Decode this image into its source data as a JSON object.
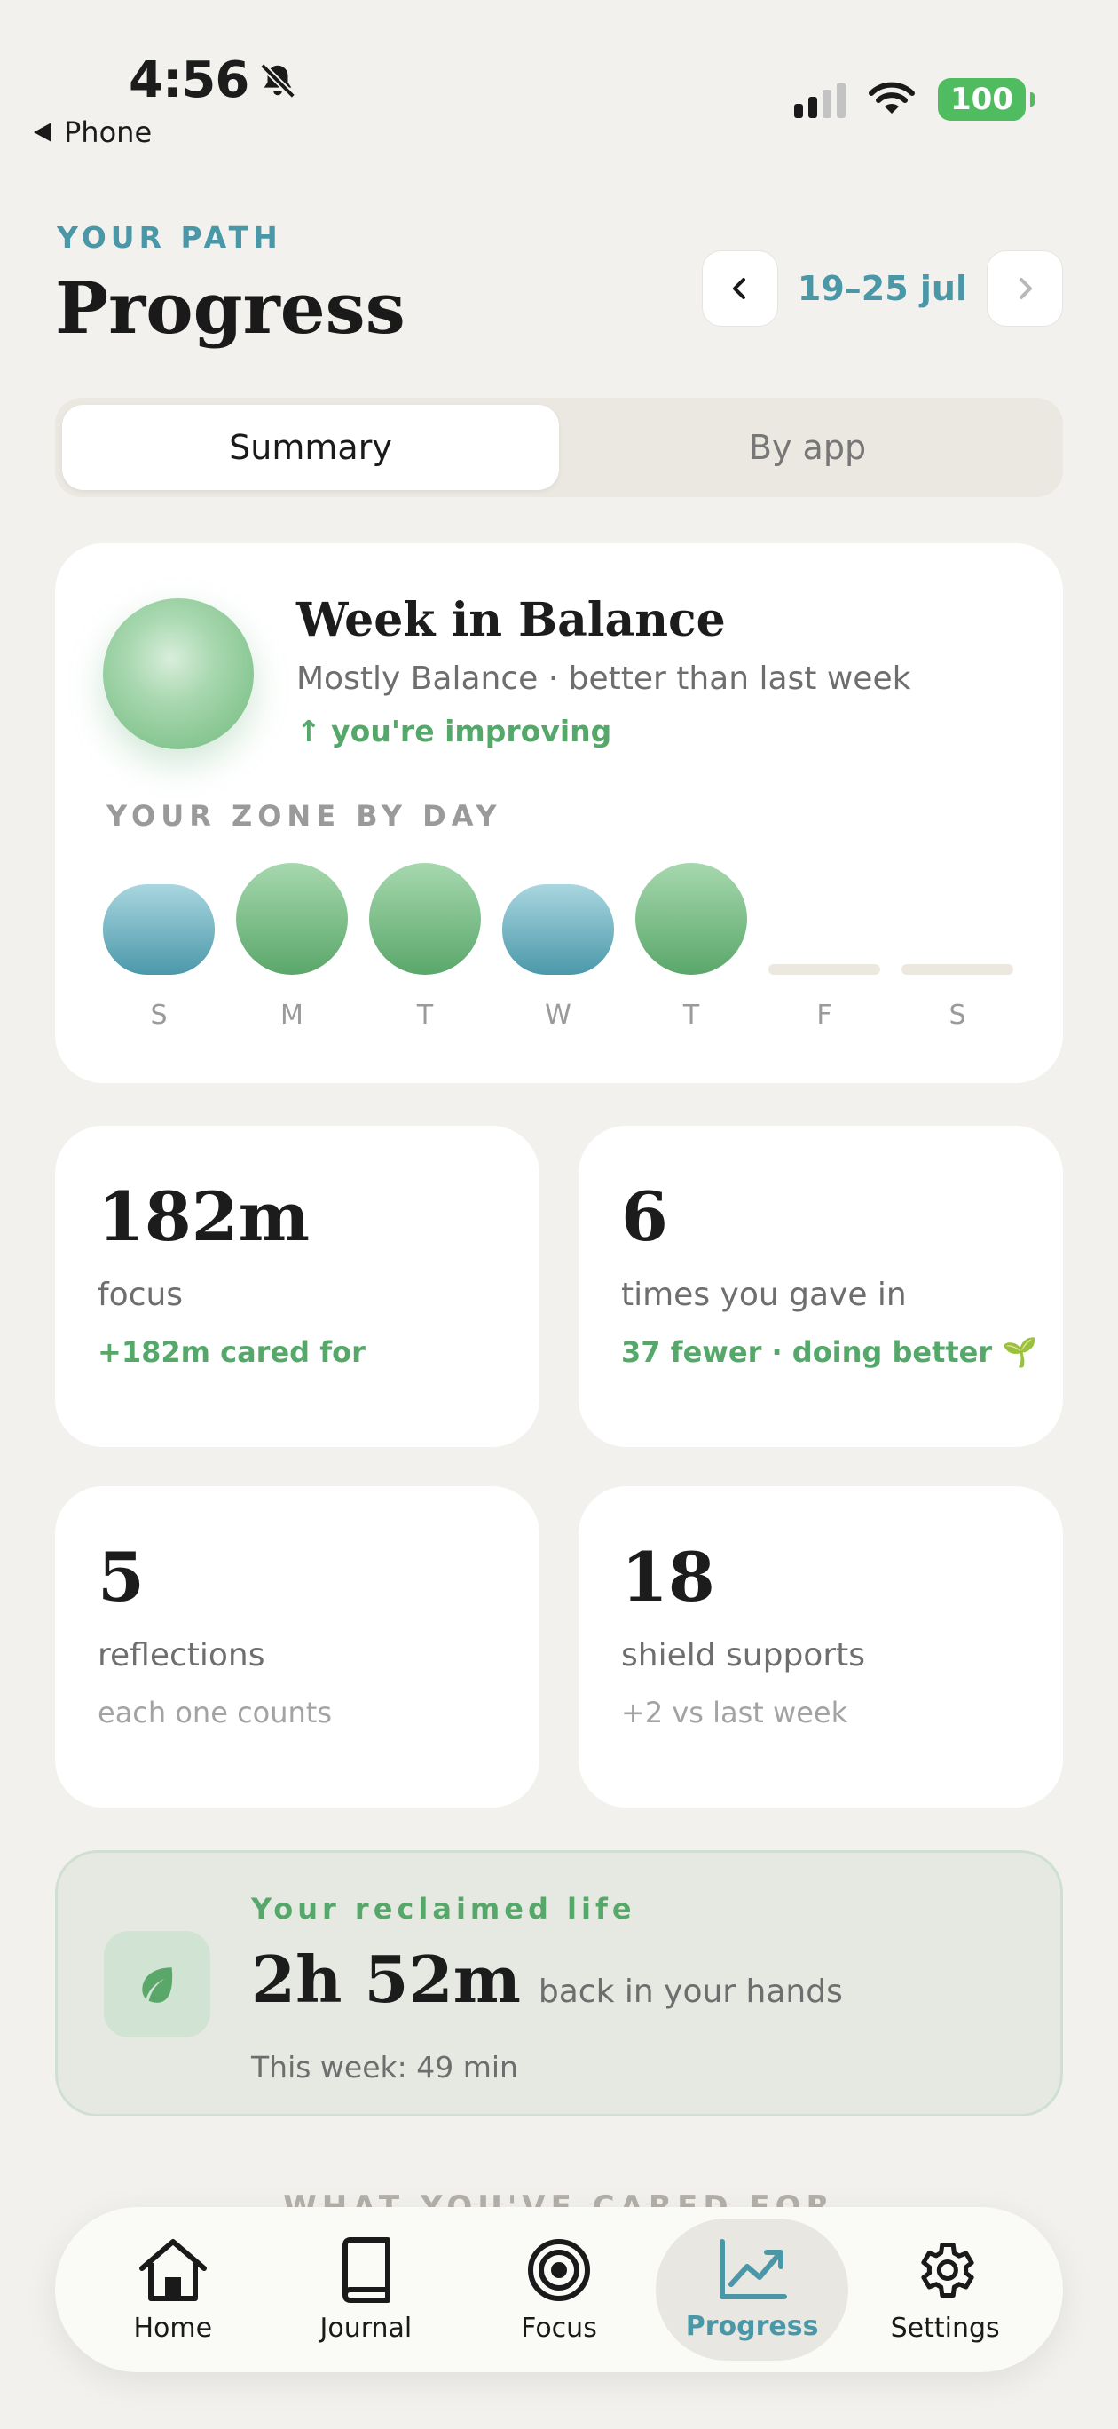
{
  "status_bar": {
    "time": "4:56",
    "back_label": "Phone",
    "battery": "100"
  },
  "header": {
    "eyebrow": "YOUR PATH",
    "title": "Progress",
    "week_range": "19–25 jul"
  },
  "segmented": {
    "summary": "Summary",
    "by_app": "By app"
  },
  "balance": {
    "title": "Week in Balance",
    "subtitle": "Mostly Balance · better than last week",
    "trend": "↑ you're improving",
    "zone_label": "YOUR ZONE BY DAY",
    "days": [
      {
        "day": "S",
        "zone": "blue"
      },
      {
        "day": "M",
        "zone": "green"
      },
      {
        "day": "T",
        "zone": "green"
      },
      {
        "day": "W",
        "zone": "blue"
      },
      {
        "day": "T",
        "zone": "green"
      },
      {
        "day": "F",
        "zone": "empty"
      },
      {
        "day": "S",
        "zone": "empty"
      }
    ]
  },
  "stats": {
    "focus": {
      "value": "182m",
      "label": "focus",
      "note": "+182m cared for"
    },
    "gave_in": {
      "value": "6",
      "label": "times you gave in",
      "note": "37 fewer · doing better 🌱"
    },
    "reflections": {
      "value": "5",
      "label": "reflections",
      "note": "each one counts"
    },
    "shield": {
      "value": "18",
      "label": "shield supports",
      "note": "+2 vs last week"
    }
  },
  "reclaimed": {
    "eyebrow": "Your reclaimed life",
    "value": "2h 52m",
    "suffix": "back in your hands",
    "week": "This week: 49 min"
  },
  "section_peek": "WHAT YOU'VE CARED FOR",
  "tabs": {
    "home": "Home",
    "journal": "Journal",
    "focus": "Focus",
    "progress": "Progress",
    "settings": "Settings"
  },
  "colors": {
    "accent": "#4a97a8",
    "green": "#55a86a",
    "background": "#f2f1ed"
  }
}
